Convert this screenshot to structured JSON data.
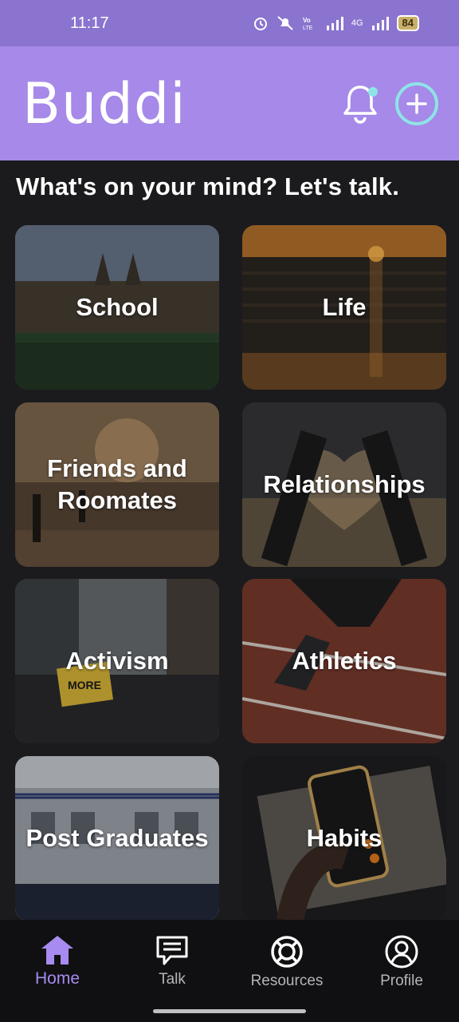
{
  "status_bar": {
    "time": "11:17",
    "network": "4G",
    "battery": "84"
  },
  "header": {
    "app_name": "Buddi",
    "bell_icon": "notification-bell-icon",
    "add_icon": "plus-circle-icon",
    "accent_color": "#a689e8"
  },
  "prompt": "What's on your mind? Let's talk.",
  "topics": [
    {
      "label": "School"
    },
    {
      "label": "Life"
    },
    {
      "label": "Friends and Roomates"
    },
    {
      "label": "Relationships"
    },
    {
      "label": "Activism"
    },
    {
      "label": "Athletics"
    },
    {
      "label": "Post Graduates"
    },
    {
      "label": "Habits"
    }
  ],
  "bottom_nav": {
    "items": [
      {
        "label": "Home",
        "icon": "home-icon",
        "active": true
      },
      {
        "label": "Talk",
        "icon": "chat-icon",
        "active": false
      },
      {
        "label": "Resources",
        "icon": "lifebuoy-icon",
        "active": false
      },
      {
        "label": "Profile",
        "icon": "user-circle-icon",
        "active": false
      }
    ]
  }
}
